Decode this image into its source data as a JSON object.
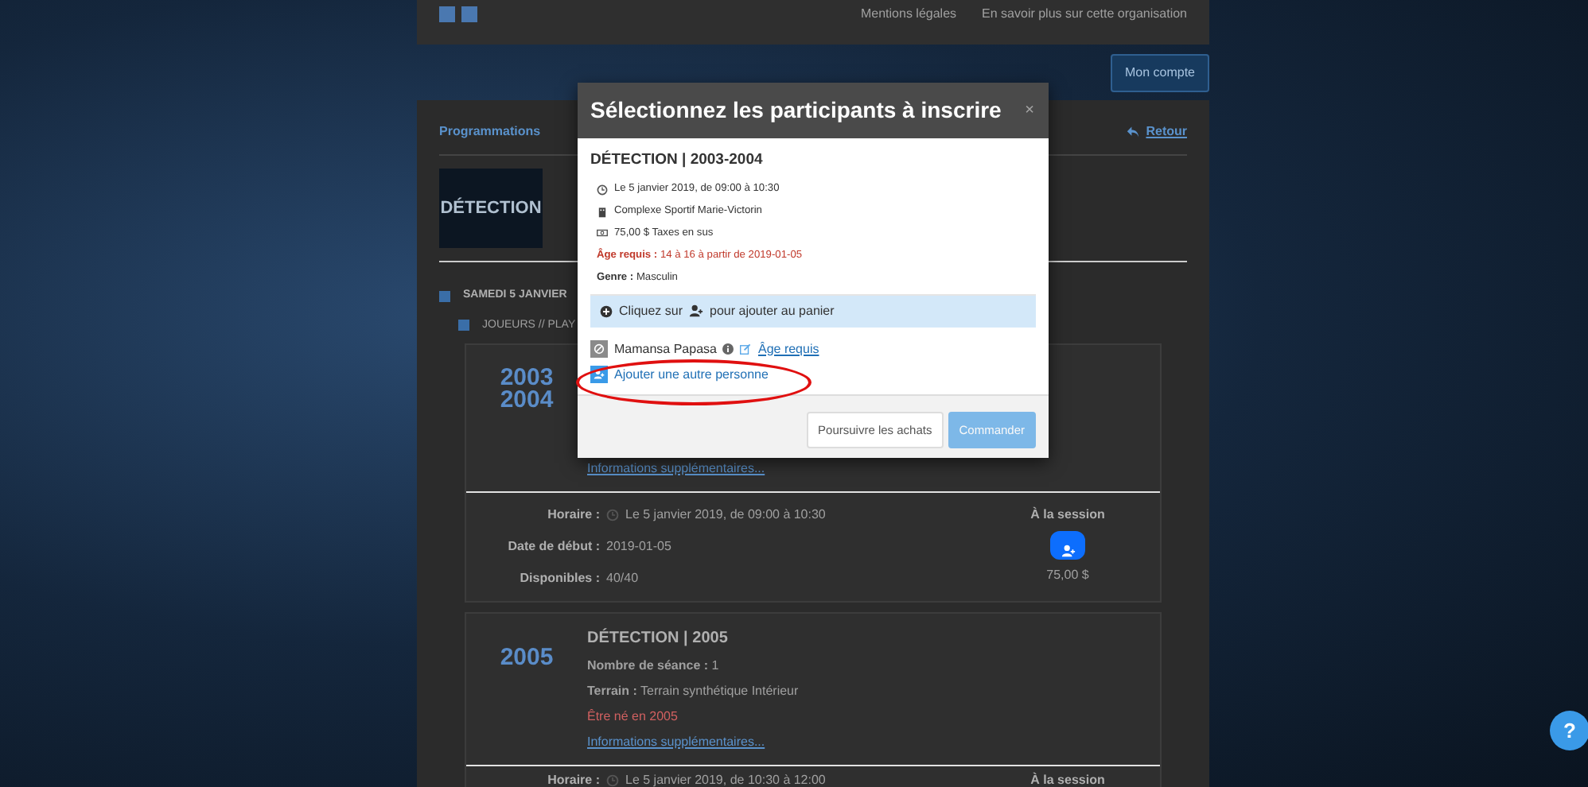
{
  "background_page": {
    "footer_links": [
      "Mentions légales",
      "En savoir plus sur cette organisation"
    ],
    "account_button": "Mon compte",
    "panel": {
      "title": "Programmations",
      "back_link": "Retour",
      "banner_text": "DÉTECTION",
      "day": "SAMEDI 5 JANVIER",
      "group": "JOUEURS // PLAY",
      "sessions": [
        {
          "logo_lines": [
            "2003",
            "2004"
          ],
          "more_link": "Informations supplémentaires...",
          "rows": [
            {
              "kind": "time",
              "label": "Horaire :",
              "value": "Le 5 janvier 2019, de 09:00 à 10:30"
            },
            {
              "kind": "plain",
              "label": "Date de début :",
              "value": "2019-01-05"
            },
            {
              "kind": "plain",
              "label": "Disponibles :",
              "value": "40/40"
            }
          ],
          "price_heading": "À la session",
          "price": "75,00 $"
        },
        {
          "logo_lines": [
            "2005"
          ],
          "title": "DÉTECTION | 2005",
          "lines": [
            {
              "kind": "field",
              "label": "Nombre de séance :",
              "value": "1"
            },
            {
              "kind": "field",
              "label": "Terrain :",
              "value": "Terrain synthétique Intérieur"
            },
            {
              "kind": "warning",
              "text": "Être né en 2005"
            }
          ],
          "more_link": "Informations supplémentaires...",
          "rows": [
            {
              "kind": "time",
              "label": "Horaire :",
              "value": "Le 5 janvier 2019, de 10:30 à 12:00"
            }
          ],
          "price_heading": "À la session"
        }
      ]
    }
  },
  "modal": {
    "title": "Sélectionnez les participants à inscrire",
    "close": "×",
    "event_title": "DÉTECTION | 2003-2004",
    "info": [
      {
        "kind": "clock",
        "text": "Le 5 janvier 2019, de 09:00 à 10:30"
      },
      {
        "kind": "building",
        "text": "Complexe Sportif Marie-Victorin"
      },
      {
        "kind": "money",
        "text": "75,00 $ Taxes en sus"
      }
    ],
    "age": {
      "label": "Âge requis :",
      "value": "14 à 16 à partir de 2019-01-05"
    },
    "gender": {
      "label": "Genre :",
      "value": "Masculin"
    },
    "notice": {
      "before": "Cliquez sur",
      "after": "pour ajouter au panier"
    },
    "participants": [
      {
        "name": "Mamansa Papasa",
        "disabled": true,
        "link": "Âge requis"
      }
    ],
    "add_link": {
      "text": "Ajouter une autre personne",
      "highlighted": true
    },
    "buttons": [
      {
        "label": "Poursuivre les achats",
        "kind": "secondary",
        "disabled": false
      },
      {
        "label": "Commander",
        "kind": "primary",
        "disabled": true
      }
    ]
  },
  "help_button": "?"
}
